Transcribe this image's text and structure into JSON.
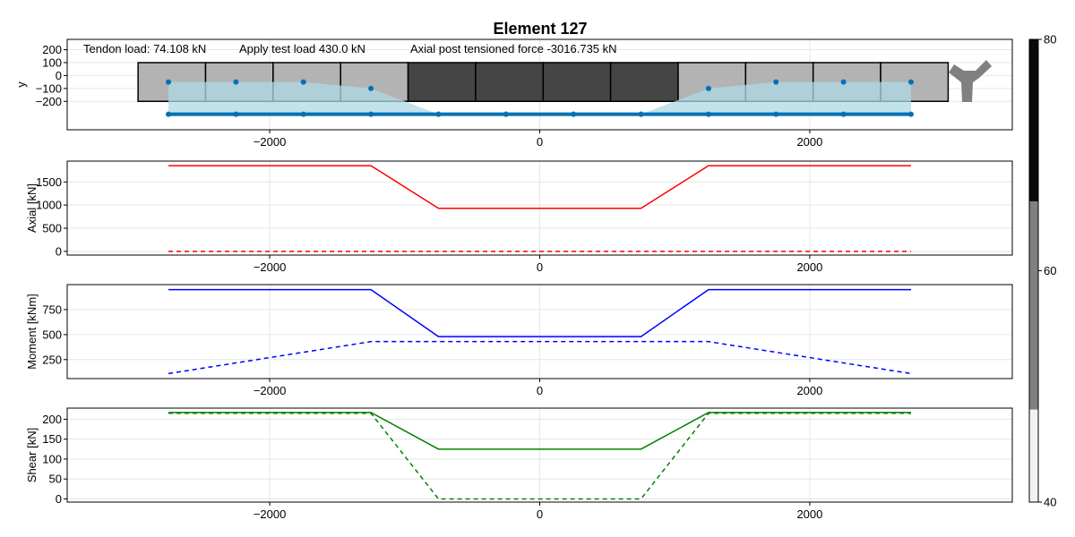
{
  "title": "Element 127",
  "annotations": {
    "tendon": "Tendon load: 74.108 kN",
    "test": "Apply test load 430.0 kN",
    "axial": "Axial post tensioned force -3016.735 kN"
  },
  "colorbar": {
    "ticks": [
      "40",
      "60",
      "80"
    ],
    "levels": [
      {
        "from": 40,
        "to": 48,
        "color": "#f2f2f2"
      },
      {
        "from": 48,
        "to": 66,
        "color": "#808080"
      },
      {
        "from": 66,
        "to": 80,
        "color": "#0a0a0a"
      }
    ]
  },
  "chart_data": [
    {
      "type": "scatter",
      "name": "section",
      "ylabel": "y",
      "xlim": [
        -3500,
        3500
      ],
      "ylim": [
        -420,
        280
      ],
      "xticks": [
        "-2000",
        "0",
        "2000"
      ],
      "yticks": [
        "200",
        "100",
        "0",
        "-100",
        "-200"
      ],
      "segments": {
        "edges": [
          -2975,
          -2475,
          -1975,
          -1475,
          -975,
          -475,
          25,
          525,
          1025,
          1525,
          2025,
          2525,
          3025
        ],
        "colors": [
          "#b3b3b3",
          "#b3b3b3",
          "#b3b3b3",
          "#b3b3b3",
          "#454545",
          "#454545",
          "#454545",
          "#454545",
          "#b3b3b3",
          "#b3b3b3",
          "#b3b3b3",
          "#b3b3b3"
        ],
        "top": 100,
        "bottom": -200
      },
      "points_x": [
        -2750,
        -2250,
        -1750,
        -1250,
        -750,
        -250,
        250,
        750,
        1250,
        1750,
        2250,
        2750
      ],
      "points_y": [
        -50,
        -50,
        -50,
        -100,
        -300,
        -300,
        -300,
        -300,
        -100,
        -50,
        -50,
        -50
      ],
      "tendon_y": -300,
      "point_color": "#0072b2",
      "fill_color": "#add8e6"
    },
    {
      "type": "line",
      "ylabel": "Axial [kN]",
      "xlim": [
        -3500,
        3500
      ],
      "ylim": [
        -80,
        1950
      ],
      "xticks": [
        "-2000",
        "0",
        "2000"
      ],
      "yticks": [
        "1500",
        "1000",
        "500",
        "0"
      ],
      "series": [
        {
          "style": "solid",
          "color": "#ff0000",
          "x": [
            -2750,
            -1250,
            -750,
            750,
            1250,
            2750
          ],
          "y": [
            1850,
            1850,
            930,
            930,
            1850,
            1850
          ]
        },
        {
          "style": "dashed",
          "color": "#ff0000",
          "x": [
            -2750,
            2750
          ],
          "y": [
            0,
            0
          ]
        }
      ]
    },
    {
      "type": "line",
      "ylabel": "Moment [kNm]",
      "xlim": [
        -3500,
        3500
      ],
      "ylim": [
        60,
        1000
      ],
      "xticks": [
        "-2000",
        "0",
        "2000"
      ],
      "yticks": [
        "750",
        "500",
        "250"
      ],
      "series": [
        {
          "style": "solid",
          "color": "#0000ff",
          "x": [
            -2750,
            -1250,
            -750,
            750,
            1250,
            2750
          ],
          "y": [
            950,
            950,
            480,
            480,
            950,
            950
          ]
        },
        {
          "style": "dashed",
          "color": "#0000ff",
          "x": [
            -2750,
            -1250,
            1250,
            2750
          ],
          "y": [
            110,
            430,
            430,
            110
          ]
        }
      ]
    },
    {
      "type": "line",
      "ylabel": "Shear [kN]",
      "xlim": [
        -3500,
        3500
      ],
      "ylim": [
        -8,
        228
      ],
      "xticks": [
        "-2000",
        "0",
        "2000"
      ],
      "yticks": [
        "200",
        "150",
        "100",
        "50",
        "0"
      ],
      "series": [
        {
          "style": "solid",
          "color": "#008000",
          "x": [
            -2750,
            -1250,
            -750,
            750,
            1250,
            2750
          ],
          "y": [
            217,
            217,
            125,
            125,
            217,
            217
          ]
        },
        {
          "style": "dashed",
          "color": "#008000",
          "x": [
            -2750,
            -1250,
            -750,
            750,
            1250,
            2750
          ],
          "y": [
            215,
            215,
            0,
            0,
            215,
            215
          ]
        }
      ]
    }
  ]
}
